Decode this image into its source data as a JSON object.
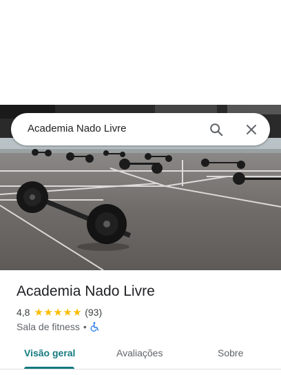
{
  "search": {
    "query": "Academia Nado Livre"
  },
  "icons": {
    "search": "search-icon",
    "close": "close-icon",
    "accessibility": "wheelchair-icon"
  },
  "place": {
    "name": "Academia Nado Livre",
    "rating_text": "4,8",
    "rating": 4.8,
    "stars": [
      "★",
      "★",
      "★",
      "★",
      "★"
    ],
    "review_count": "(93)",
    "category": "Sala de fitness",
    "separator": "•"
  },
  "tabs": [
    {
      "label": "Visão geral",
      "active": true
    },
    {
      "label": "Avaliações",
      "active": false
    },
    {
      "label": "Sobre",
      "active": false
    }
  ],
  "colors": {
    "accent": "#137a7f",
    "star": "#fbbc04",
    "wheelchair": "#1a73e8"
  }
}
